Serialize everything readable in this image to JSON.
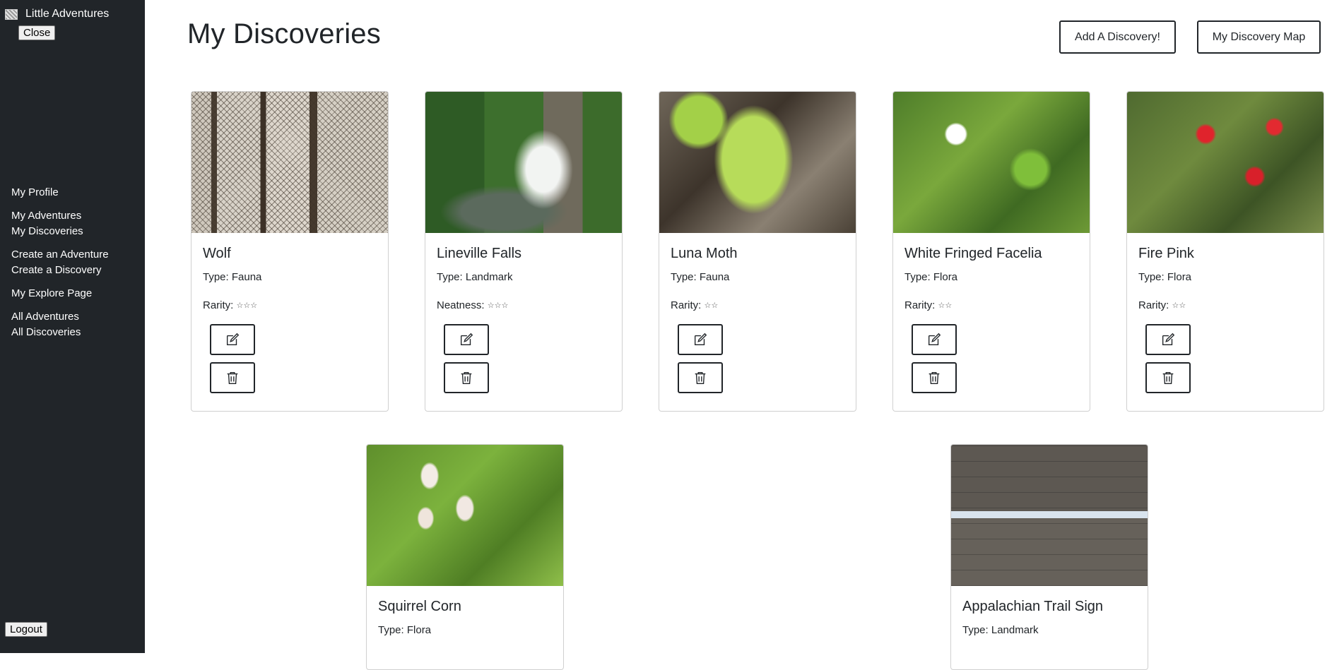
{
  "sidebar": {
    "brand": "Little Adventures",
    "close_label": "Close",
    "logout_label": "Logout",
    "nav": [
      {
        "label": "My Profile"
      },
      {
        "label": "My Adventures"
      },
      {
        "label": "My Discoveries"
      },
      {
        "label": "Create an Adventure"
      },
      {
        "label": "Create a Discovery"
      },
      {
        "label": "My Explore Page"
      },
      {
        "label": "All Adventures"
      },
      {
        "label": "All Discoveries"
      }
    ]
  },
  "header": {
    "title": "My Discoveries",
    "add_label": "Add A Discovery!",
    "map_label": "My Discovery Map"
  },
  "cards": [
    {
      "title": "Wolf",
      "type": "Type: Fauna",
      "meta_label": "Rarity:",
      "stars": "☆☆☆"
    },
    {
      "title": "Lineville Falls",
      "type": "Type: Landmark",
      "meta_label": "Neatness:",
      "stars": "☆☆☆"
    },
    {
      "title": "Luna Moth",
      "type": "Type: Fauna",
      "meta_label": "Rarity:",
      "stars": "☆☆"
    },
    {
      "title": "White Fringed Facelia",
      "type": "Type: Flora",
      "meta_label": "Rarity:",
      "stars": "☆☆"
    },
    {
      "title": "Fire Pink",
      "type": "Type: Flora",
      "meta_label": "Rarity:",
      "stars": "☆☆"
    },
    {
      "title": "Squirrel Corn",
      "type": "Type: Flora"
    },
    {
      "title": "Appalachian Trail Sign",
      "type": "Type: Landmark"
    }
  ],
  "icons": {
    "edit": "edit-icon",
    "delete": "trash-icon"
  }
}
